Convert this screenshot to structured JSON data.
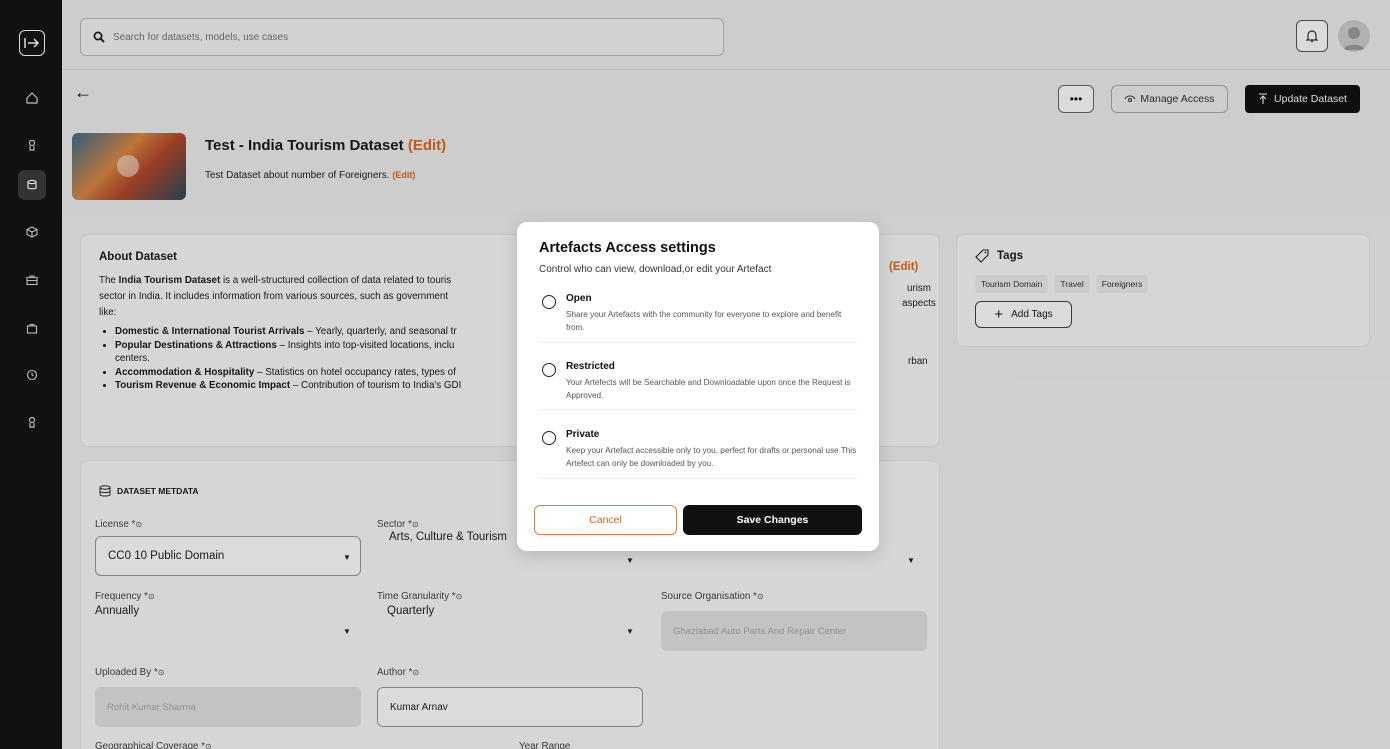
{
  "search": {
    "placeholder": "Search for datasets, models, use cases"
  },
  "header": {
    "manage_access": "Manage Access",
    "update_dataset": "Update Dataset",
    "title": "Test - India Tourism Dataset",
    "edit_label": "(Edit)",
    "description": "Test Dataset about number of Foreigners.",
    "desc_edit": "(Edit)"
  },
  "about": {
    "title": "About Dataset",
    "edit": "(Edit)",
    "intro_bold": "India Tourism Dataset",
    "intro_pre": "The ",
    "intro_post": " is a well-structured collection of data related to touris",
    "line2": "sector in India. It includes information from various sources, such as government",
    "line3": "like:",
    "frag_urism": "urism",
    "frag_aspects": "aspects",
    "frag_rban": "rban",
    "bullets": [
      {
        "bold": "Domestic & International Tourist Arrivals",
        "text": " – Yearly, quarterly, and seasonal tr"
      },
      {
        "bold": "Popular Destinations & Attractions",
        "text": " – Insights into top-visited locations, inclu"
      },
      {
        "bold": "",
        "text": "centers."
      },
      {
        "bold": "Accommodation & Hospitality",
        "text": " – Statistics on hotel occupancy rates, types of"
      },
      {
        "bold": "Tourism Revenue & Economic Impact",
        "text": " – Contribution of tourism to India's GDI"
      }
    ]
  },
  "tags": {
    "title": "Tags",
    "items": [
      "Tourism Domain",
      "Travel",
      "Foreigners"
    ],
    "add_label": "Add Tags"
  },
  "metadata": {
    "heading": "DATASET METDATA",
    "license_label": "License *",
    "license_value": "CC0 10 Public Domain",
    "sector_label": "Sector *",
    "sector_value": "Arts, Culture & Tourism",
    "frequency_label": "Frequency *",
    "frequency_value": "Annually",
    "time_gran_label": "Time Granularity *",
    "time_gran_value": "Quarterly",
    "source_org_label": "Source Organisation *",
    "source_org_value": "Ghaziabad Auto Parts And Repair Center",
    "uploaded_by_label": "Uploaded By *",
    "uploaded_by_value": "Rohit Kumar Sharma",
    "author_label": "Author *",
    "author_value": "Kumar Arnav",
    "geo_label": "Geographical Coverage *",
    "year_range_label": "Year Range"
  },
  "modal": {
    "title": "Artefacts Access settings",
    "subtitle": "Control who can view, download,or edit your Artefact",
    "options": [
      {
        "title": "Open",
        "desc": "Share your Artefacts with the community for everyone to explore and benefit from."
      },
      {
        "title": "Restricted",
        "desc": "Your Artefects will be Searchable and Downloadable upon once the Request is Approved."
      },
      {
        "title": "Private",
        "desc": "Keep your Artefact accessible only to you, perfect for drafts or personal use This Artefect can only be downloaded by you."
      }
    ],
    "cancel": "Cancel",
    "save": "Save Changes"
  },
  "colors": {
    "accent": "#e06a1b",
    "dark": "#111111"
  }
}
